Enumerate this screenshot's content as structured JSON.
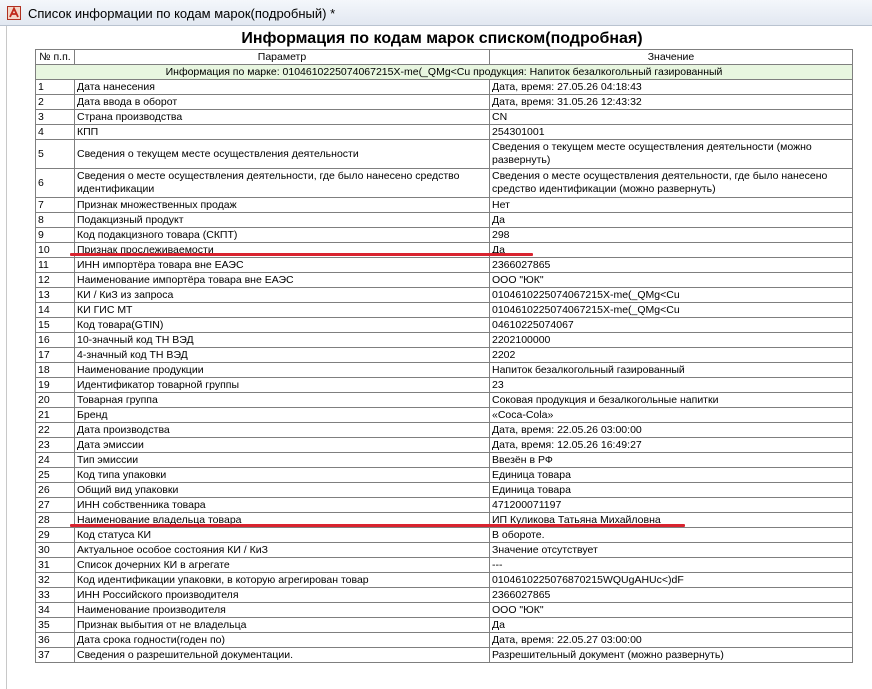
{
  "window": {
    "title": "Список информации по кодам марок(подробный)  *"
  },
  "report": {
    "title": "Информация по кодам марок списком(подробная)",
    "columns": [
      "№ п.п.",
      "Параметр",
      "Значение"
    ],
    "group_header": "Информация по марке: 0104610225074067215X-me(_QMg<Cu продукция: Напиток безалкогольный газированный",
    "rows": [
      {
        "n": "1",
        "param": "Дата нанесения",
        "value": "Дата, время: 27.05.26 04:18:43"
      },
      {
        "n": "2",
        "param": "Дата ввода в оборот",
        "value": "Дата, время: 31.05.26 12:43:32"
      },
      {
        "n": "3",
        "param": "Страна производства",
        "value": "CN"
      },
      {
        "n": "4",
        "param": "КПП",
        "value": "254301001"
      },
      {
        "n": "5",
        "param": "Сведения о текущем месте осуществления деятельности",
        "value": "Сведения о текущем месте осуществления деятельности (можно развернуть)"
      },
      {
        "n": "6",
        "param": "Сведения о месте осуществления деятельности, где было нанесено средство идентификации",
        "value": "Сведения о месте осуществления деятельности, где было нанесено средство идентификации (можно развернуть)"
      },
      {
        "n": "7",
        "param": "Признак множественных продаж",
        "value": "Нет"
      },
      {
        "n": "8",
        "param": "Подакцизный продукт",
        "value": "Да"
      },
      {
        "n": "9",
        "param": "Код подакцизного товара (СКПТ)",
        "value": "298"
      },
      {
        "n": "10",
        "param": "Признак прослеживаемости",
        "value": "Да"
      },
      {
        "n": "11",
        "param": "ИНН импортёра товара вне ЕАЭС",
        "value": "2366027865"
      },
      {
        "n": "12",
        "param": "Наименование импортёра товара вне ЕАЭС",
        "value": "ООО \"ЮК\""
      },
      {
        "n": "13",
        "param": "КИ / КиЗ из запроса",
        "value": "0104610225074067215X-me(_QMg<Cu"
      },
      {
        "n": "14",
        "param": "КИ ГИС МТ",
        "value": "0104610225074067215X-me(_QMg<Cu"
      },
      {
        "n": "15",
        "param": "Код товара(GTIN)",
        "value": "04610225074067"
      },
      {
        "n": "16",
        "param": "10-значный код ТН ВЭД",
        "value": "2202100000"
      },
      {
        "n": "17",
        "param": "4-значный код ТН ВЭД",
        "value": "2202"
      },
      {
        "n": "18",
        "param": "Наименование продукции",
        "value": "Напиток безалкогольный газированный"
      },
      {
        "n": "19",
        "param": "Идентификатор товарной группы",
        "value": "23"
      },
      {
        "n": "20",
        "param": "Товарная группа",
        "value": "Соковая продукция и безалкогольные напитки"
      },
      {
        "n": "21",
        "param": "Бренд",
        "value": "«Coca-Cola»"
      },
      {
        "n": "22",
        "param": "Дата производства",
        "value": "Дата, время: 22.05.26 03:00:00"
      },
      {
        "n": "23",
        "param": "Дата эмиссии",
        "value": "Дата, время: 12.05.26 16:49:27"
      },
      {
        "n": "24",
        "param": "Тип эмиссии",
        "value": "Ввезён в РФ"
      },
      {
        "n": "25",
        "param": "Код типа упаковки",
        "value": "Единица товара"
      },
      {
        "n": "26",
        "param": "Общий вид упаковки",
        "value": "Единица товара"
      },
      {
        "n": "27",
        "param": "ИНН собственника товара",
        "value": "471200071197"
      },
      {
        "n": "28",
        "param": "Наименование владельца товара",
        "value": "ИП Куликова Татьяна Михайловна"
      },
      {
        "n": "29",
        "param": "Код статуса КИ",
        "value": "В обороте."
      },
      {
        "n": "30",
        "param": "Актуальное особое состояния КИ / КиЗ",
        "value": "Значение отсутствует"
      },
      {
        "n": "31",
        "param": "Список дочерних КИ в агрегате",
        "value": "---"
      },
      {
        "n": "32",
        "param": "Код идентификации упаковки, в которую агрегирован товар",
        "value": "0104610225076870215WQUgAHUc<)dF"
      },
      {
        "n": "33",
        "param": "ИНН Российского производителя",
        "value": "2366027865"
      },
      {
        "n": "34",
        "param": "Наименование производителя",
        "value": "ООО \"ЮК\""
      },
      {
        "n": "35",
        "param": "Признак выбытия от не владельца",
        "value": "Да"
      },
      {
        "n": "36",
        "param": "Дата срока годности(годен по)",
        "value": "Дата, время: 22.05.27 03:00:00"
      },
      {
        "n": "37",
        "param": "Сведения о разрешительной документации.",
        "value": "Разрешительный документ (можно развернуть)"
      }
    ]
  },
  "annotations": {
    "underline_color": "#d9232f",
    "underlined_rows": [
      "10",
      "28"
    ]
  },
  "colors": {
    "group_header_bg": "#e8f6e0",
    "grid": "#7f7f7f"
  }
}
